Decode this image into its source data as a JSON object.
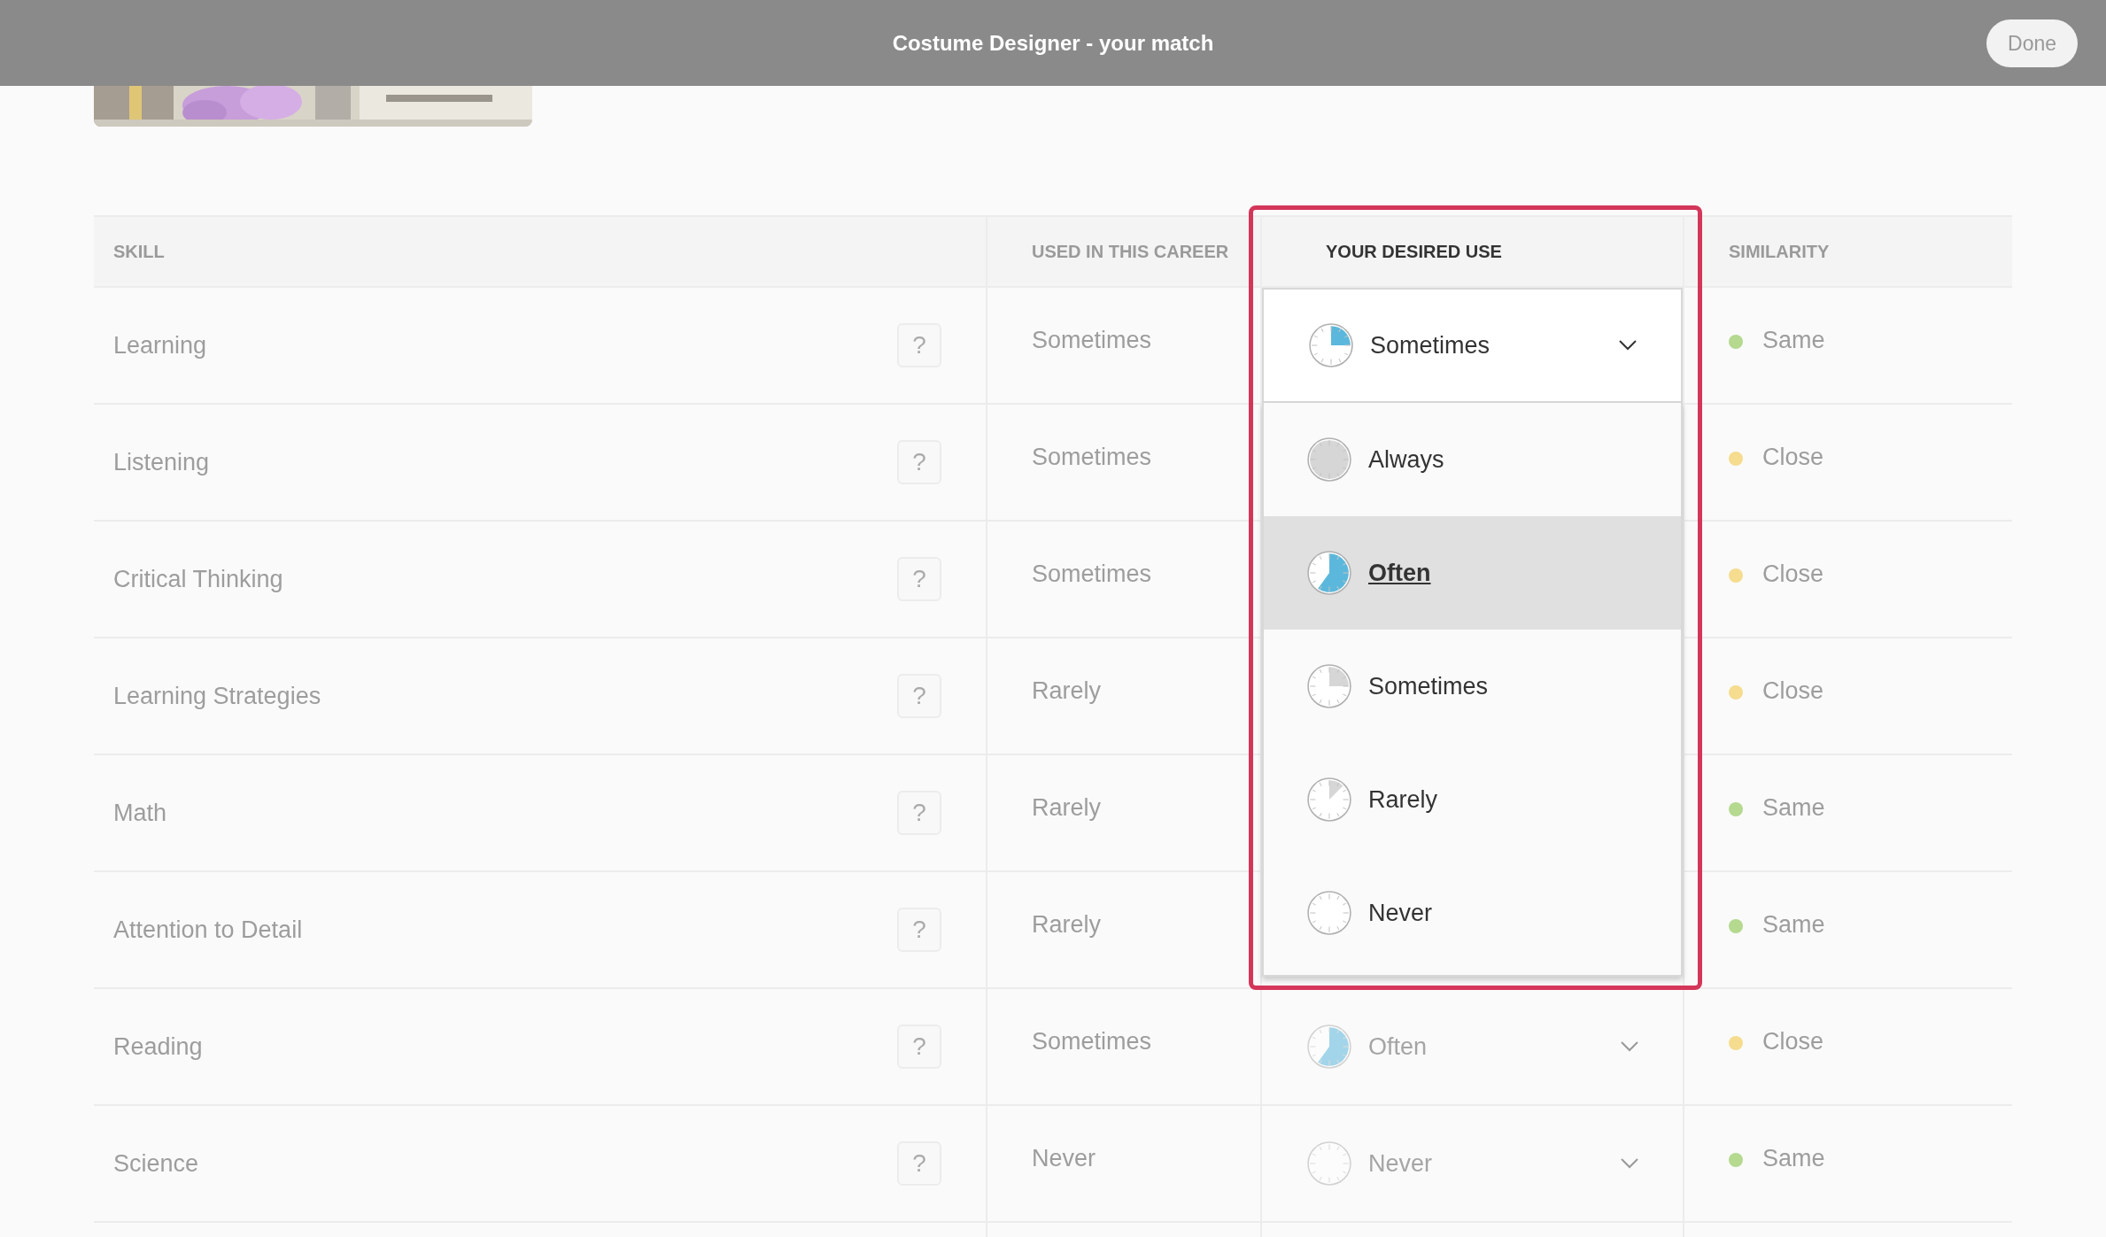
{
  "header": {
    "title": "Costume Designer - your match",
    "done_button": "Done"
  },
  "table": {
    "columns": [
      "SKILL",
      "USED IN THIS CAREER",
      "YOUR DESIRED USE",
      "SIMILARITY"
    ],
    "rows": [
      {
        "skill": "Learning",
        "help": "?",
        "used": "Sometimes",
        "desired": {
          "value": "Sometimes",
          "kind": "sometimes",
          "expanded": true
        },
        "similarity": "Same",
        "color": "#b4d98f"
      },
      {
        "skill": "Listening",
        "help": "?",
        "used": "Sometimes",
        "similarity": "Close",
        "color": "#f5dc8e"
      },
      {
        "skill": "Critical Thinking",
        "help": "?",
        "used": "Sometimes",
        "similarity": "Close",
        "color": "#f5dc8e"
      },
      {
        "skill": "Learning Strategies",
        "help": "?",
        "used": "Rarely",
        "similarity": "Close",
        "color": "#f5dc8e"
      },
      {
        "skill": "Math",
        "help": "?",
        "used": "Rarely",
        "similarity": "Same",
        "color": "#b4d98f"
      },
      {
        "skill": "Attention to Detail",
        "help": "?",
        "used": "Rarely",
        "similarity": "Same",
        "color": "#b4d98f"
      },
      {
        "skill": "Reading",
        "help": "?",
        "used": "Sometimes",
        "desired": {
          "value": "Often",
          "kind": "often",
          "expanded": false
        },
        "similarity": "Close",
        "color": "#f5dc8e"
      },
      {
        "skill": "Science",
        "help": "?",
        "used": "Never",
        "desired": {
          "value": "Never",
          "kind": "never",
          "expanded": false
        },
        "similarity": "Same",
        "color": "#b4d98f"
      }
    ],
    "dropdown": {
      "options": [
        {
          "label": "Always",
          "kind": "always",
          "selected": false
        },
        {
          "label": "Often",
          "kind": "often",
          "selected": true
        },
        {
          "label": "Sometimes",
          "kind": "sometimes",
          "selected": false
        },
        {
          "label": "Rarely",
          "kind": "rarely",
          "selected": false
        },
        {
          "label": "Never",
          "kind": "never",
          "selected": false
        }
      ]
    }
  }
}
